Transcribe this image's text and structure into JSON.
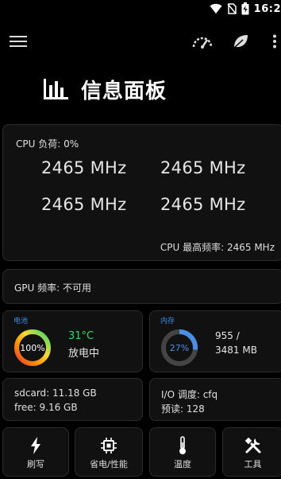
{
  "status_bar": {
    "time": "16:2"
  },
  "toolbar": {
    "menu_icon": "menu-icon",
    "speed_icon": "speedometer-icon",
    "leaf_icon": "leaf-icon",
    "more_icon": "more-vert-icon"
  },
  "title": "信息面板",
  "cpu": {
    "load_label": "CPU 负荷: 0%",
    "frequencies": [
      "2465 MHz",
      "2465 MHz",
      "2465 MHz",
      "2465 MHz"
    ],
    "max_freq_label": "CPU 最高频率: 2465 MHz"
  },
  "gpu": {
    "freq_label": "GPU 频率: 不可用"
  },
  "battery": {
    "label": "电池",
    "percent_text": "100%",
    "percent": 1.0,
    "temperature": "31°C",
    "state": "放电中",
    "ring_color": "#2fdc6a"
  },
  "memory": {
    "label": "内存",
    "percent_text": "27%",
    "percent": 0.27,
    "used": "955 /",
    "total": "3481 MB",
    "ring_color": "#4a8fe6"
  },
  "storage": {
    "sdcard": "sdcard: 11.18 GB",
    "free": "free: 9.16 GB"
  },
  "io": {
    "scheduler": "I/O 调度: cfq",
    "readahead": "预读: 128"
  },
  "tools": [
    {
      "label": "刷写",
      "icon": "flash-icon"
    },
    {
      "label": "省电/性能",
      "icon": "chip-icon"
    },
    {
      "label": "温度",
      "icon": "thermometer-icon"
    },
    {
      "label": "工具",
      "icon": "tools-icon"
    }
  ],
  "colors": {
    "accent_blue": "#3d8ee8",
    "battery_green": "#2fdc6a",
    "background": "#000000",
    "card": "#111111"
  }
}
